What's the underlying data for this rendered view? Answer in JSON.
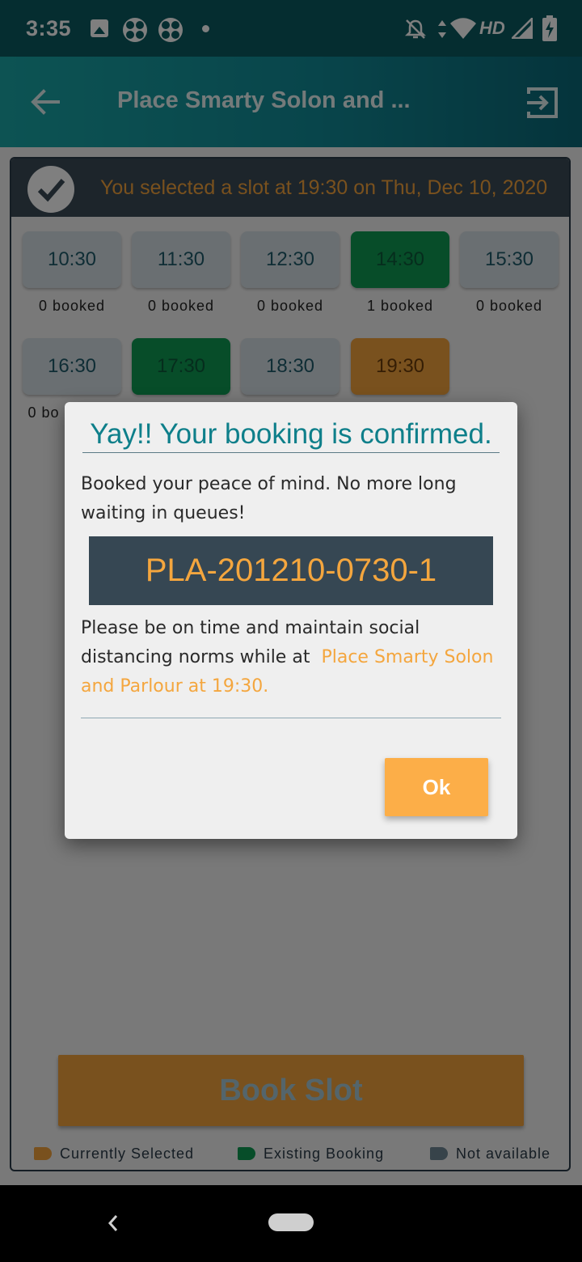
{
  "status_bar": {
    "time": "3:35",
    "network": "HD",
    "icons": [
      "gallery-icon",
      "app-icon",
      "app-icon",
      "dot-icon",
      "notifications-off-icon",
      "data-arrows-icon",
      "wifi-icon",
      "signal-icon",
      "battery-charging-icon"
    ]
  },
  "app_bar": {
    "title": "Place Smarty Solon and ...",
    "back_icon": "arrow-left-icon",
    "exit_icon": "exit-icon"
  },
  "selection": {
    "text": "You selected a slot at 19:30 on Thu, Dec 10, 2020"
  },
  "slots": [
    {
      "time": "10:30",
      "count": "0 booked",
      "state": "available"
    },
    {
      "time": "11:30",
      "count": "0 booked",
      "state": "available"
    },
    {
      "time": "12:30",
      "count": "0 booked",
      "state": "available"
    },
    {
      "time": "14:30",
      "count": "1 booked",
      "state": "existing"
    },
    {
      "time": "15:30",
      "count": "0 booked",
      "state": "available"
    },
    {
      "time": "16:30",
      "count": "0 bo",
      "state": "available"
    },
    {
      "time": "17:30",
      "count": "",
      "state": "existing"
    },
    {
      "time": "18:30",
      "count": "",
      "state": "available"
    },
    {
      "time": "19:30",
      "count": "",
      "state": "selected"
    }
  ],
  "book_button": "Book Slot",
  "legend": {
    "selected": "Currently Selected",
    "existing": "Existing Booking",
    "unavailable": "Not available"
  },
  "colors": {
    "selected": "#f2a23c",
    "existing": "#0e9a52",
    "unavailable": "#3a4a56",
    "accent": "#0e7f8a"
  },
  "dialog": {
    "title": "Yay!! Your booking is confirmed.",
    "message": "Booked your peace of mind. No more long waiting in queues!",
    "token": "PLA-201210-0730-1",
    "instruction": "Please be on time and maintain social distancing norms while at",
    "place": "Place Smarty Solon and Parlour at 19:30.",
    "ok_label": "Ok"
  }
}
